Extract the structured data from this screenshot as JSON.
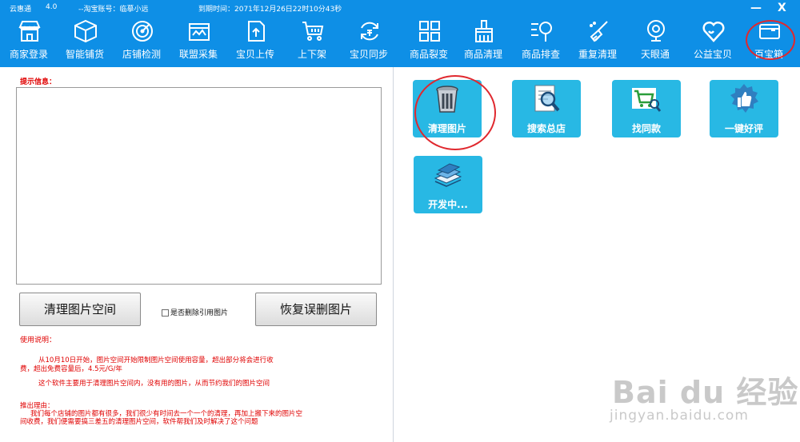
{
  "window": {
    "app_name": "云惠通",
    "version": "4.0",
    "account": "--淘宝账号：临摹小远",
    "expiry": "到期时间：2071年12月26日22时10分43秒",
    "minimize": "—",
    "close": "X"
  },
  "toolbar": [
    {
      "label": "商家登录",
      "icon": "store-icon"
    },
    {
      "label": "智能铺货",
      "icon": "box-icon"
    },
    {
      "label": "店铺检测",
      "icon": "radar-icon"
    },
    {
      "label": "联盟采集",
      "icon": "collect-icon"
    },
    {
      "label": "宝贝上传",
      "icon": "upload-doc-icon"
    },
    {
      "label": "上下架",
      "icon": "cart-icon"
    },
    {
      "label": "宝贝同步",
      "icon": "sync-icon"
    },
    {
      "label": "商品裂变",
      "icon": "grid-icon"
    },
    {
      "label": "商品清理",
      "icon": "brush-icon"
    },
    {
      "label": "商品排查",
      "icon": "search-list-icon"
    },
    {
      "label": "重复清理",
      "icon": "broom-icon"
    },
    {
      "label": "天眼通",
      "icon": "webcam-icon"
    },
    {
      "label": "公益宝贝",
      "icon": "heart-icon"
    },
    {
      "label": "百宝箱",
      "icon": "wallet-icon"
    }
  ],
  "left_panel": {
    "tip_label": "提示信息：",
    "textbox_value": "",
    "clean_button": "清理图片空间",
    "restore_button": "恢复误删图片",
    "checkbox_label": "是否删除引用图片",
    "checkbox_checked": false,
    "usage_title": "使用说明：",
    "usage_p1_line1": "从10月10日开始，图片空间开始限制图片空间使用容量，超出部分将会进行收",
    "usage_p1_line2": "费，超出免费容量后，4.5元/G/年",
    "usage_p2": "这个软件主要用于清理图片空间内，没有用的图片，从而节约我们的图片空间",
    "reason_title": "推出理由：",
    "reason_line1": "我们每个店铺的图片都有很多，我们很少有时间去一个一个的清理，再加上搬下来的图片空",
    "reason_line2": "间收费，我们便需要搞三差五的清理图片空间，软件帮我们及时解决了这个问题"
  },
  "tools": [
    {
      "label": "清理图片",
      "icon": "trash-icon"
    },
    {
      "label": "搜索总店",
      "icon": "search-doc-icon"
    },
    {
      "label": "找同款",
      "icon": "cart-search-icon"
    },
    {
      "label": "一键好评",
      "icon": "thumbs-up-icon"
    },
    {
      "label": "开发中...",
      "icon": "stack-icon"
    }
  ],
  "watermark": {
    "main": "Bai du 经验",
    "sub": "jingyan.baidu.com"
  },
  "colors": {
    "toolbar_bg": "#0e8fe6",
    "card_bg": "#28b8e4",
    "alert_red": "#e00000",
    "circle_red": "#e0282e"
  }
}
